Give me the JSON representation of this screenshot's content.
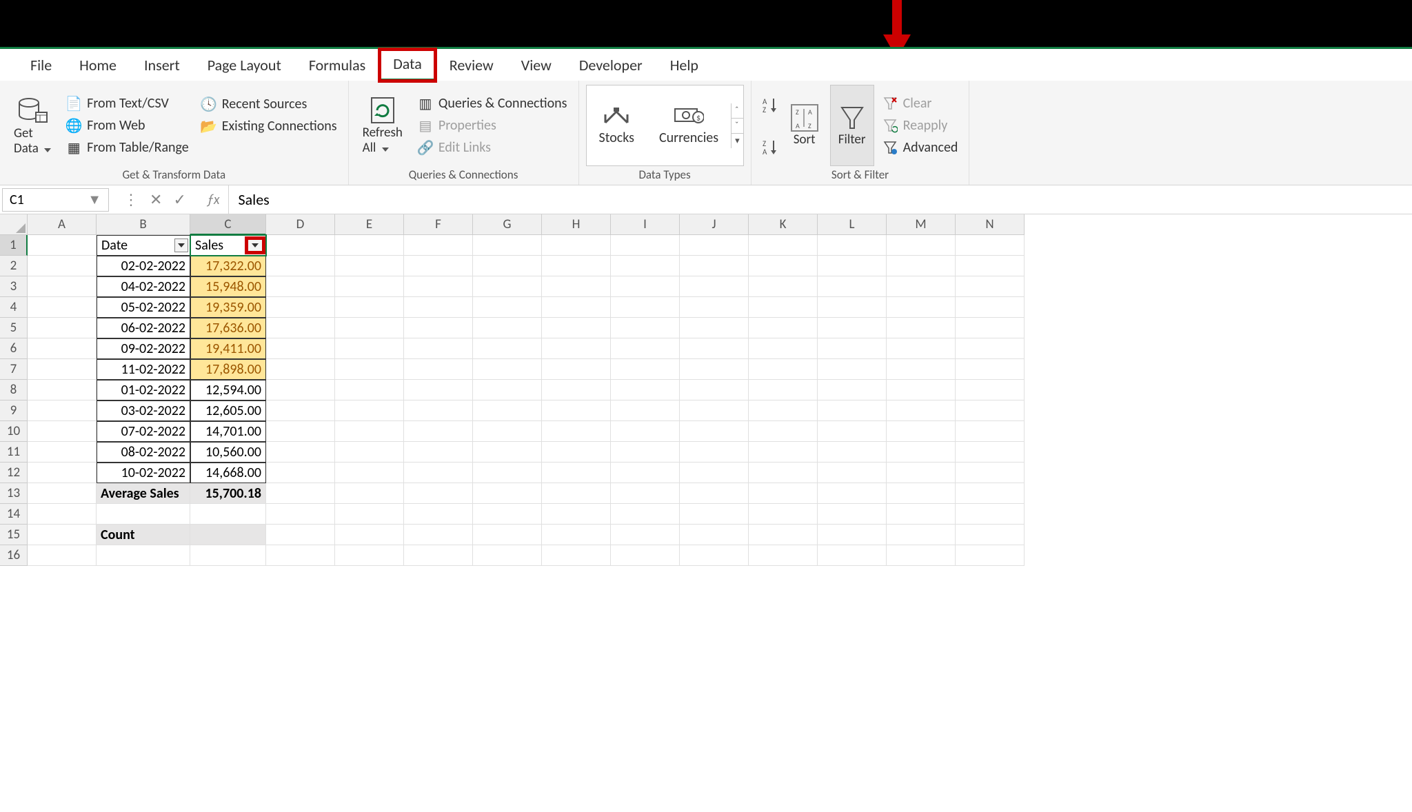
{
  "tabs": {
    "file": "File",
    "home": "Home",
    "insert": "Insert",
    "pageLayout": "Page Layout",
    "formulas": "Formulas",
    "data": "Data",
    "review": "Review",
    "view": "View",
    "developer": "Developer",
    "help": "Help"
  },
  "ribbon": {
    "getData": "Get\nData",
    "fromTextCsv": "From Text/CSV",
    "fromWeb": "From Web",
    "fromTableRange": "From Table/Range",
    "recentSources": "Recent Sources",
    "existingConnections": "Existing Connections",
    "groupGetTransform": "Get & Transform Data",
    "refreshAll": "Refresh\nAll",
    "queriesConnections": "Queries & Connections",
    "properties": "Properties",
    "editLinks": "Edit Links",
    "groupQueries": "Queries & Connections",
    "stocks": "Stocks",
    "currencies": "Currencies",
    "groupDataTypes": "Data Types",
    "sort": "Sort",
    "filter": "Filter",
    "clear": "Clear",
    "reapply": "Reapply",
    "advanced": "Advanced",
    "groupSortFilter": "Sort & Filter"
  },
  "formulaBar": {
    "nameBox": "C1",
    "formula": "Sales"
  },
  "columns": [
    "A",
    "B",
    "C",
    "D",
    "E",
    "F",
    "G",
    "H",
    "I",
    "J",
    "K",
    "L",
    "M",
    "N"
  ],
  "rows": [
    "1",
    "2",
    "3",
    "4",
    "5",
    "6",
    "7",
    "8",
    "9",
    "10",
    "11",
    "12",
    "13",
    "14",
    "15",
    "16"
  ],
  "headers": {
    "date": "Date",
    "sales": "Sales"
  },
  "data": [
    {
      "date": "02-02-2022",
      "sales": "17,322.00",
      "hl": true
    },
    {
      "date": "04-02-2022",
      "sales": "15,948.00",
      "hl": true
    },
    {
      "date": "05-02-2022",
      "sales": "19,359.00",
      "hl": true
    },
    {
      "date": "06-02-2022",
      "sales": "17,636.00",
      "hl": true
    },
    {
      "date": "09-02-2022",
      "sales": "19,411.00",
      "hl": true
    },
    {
      "date": "11-02-2022",
      "sales": "17,898.00",
      "hl": true
    },
    {
      "date": "01-02-2022",
      "sales": "12,594.00",
      "hl": false
    },
    {
      "date": "03-02-2022",
      "sales": "12,605.00",
      "hl": false
    },
    {
      "date": "07-02-2022",
      "sales": "14,701.00",
      "hl": false
    },
    {
      "date": "08-02-2022",
      "sales": "10,560.00",
      "hl": false
    },
    {
      "date": "10-02-2022",
      "sales": "14,668.00",
      "hl": false
    }
  ],
  "summary": {
    "avgLabel": "Average Sales",
    "avgValue": "15,700.18",
    "countLabel": "Count"
  }
}
